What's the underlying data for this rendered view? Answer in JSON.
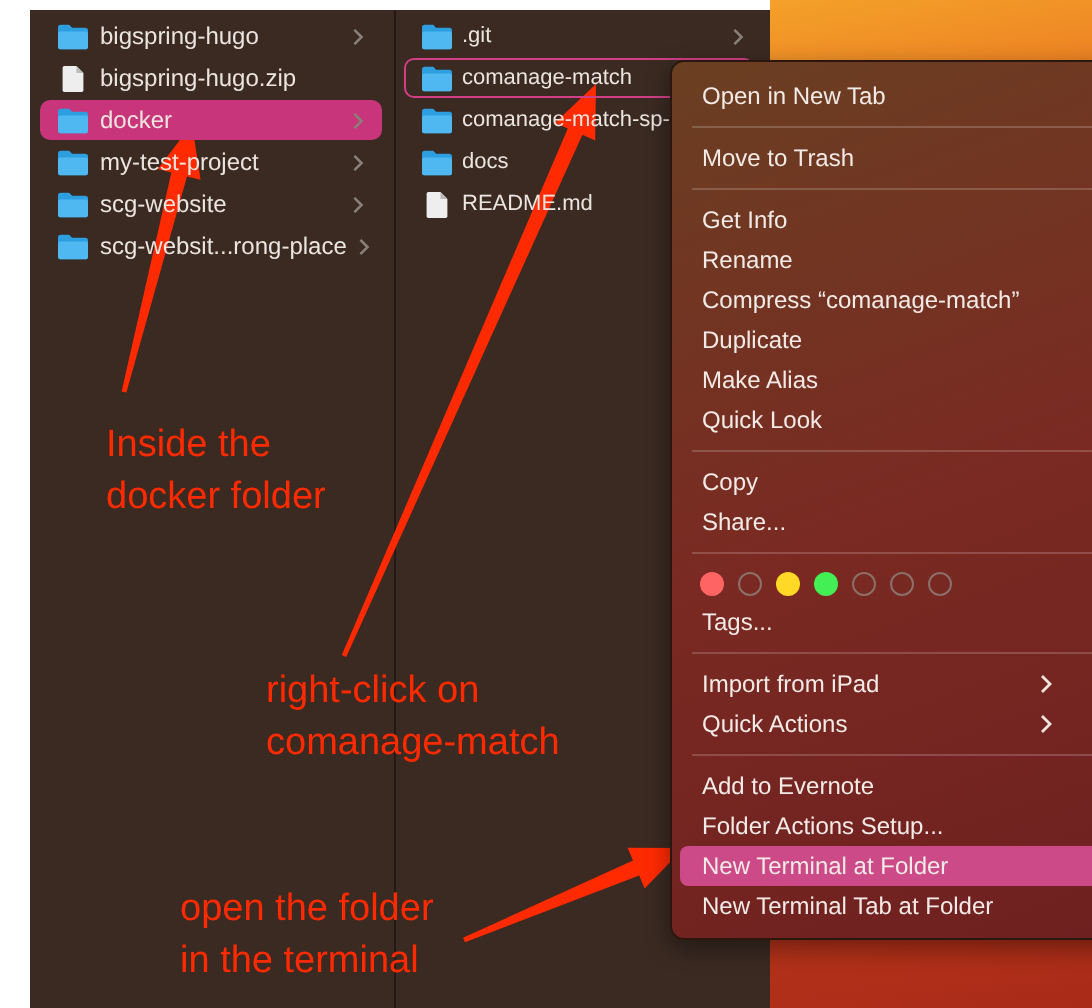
{
  "finder": {
    "columns": [
      {
        "items": [
          {
            "name": "bigspring-hugo",
            "kind": "folder",
            "selected": false,
            "context_target": false,
            "has_children": true
          },
          {
            "name": "bigspring-hugo.zip",
            "kind": "file",
            "selected": false,
            "context_target": false,
            "has_children": false
          },
          {
            "name": "docker",
            "kind": "folder",
            "selected": true,
            "context_target": false,
            "has_children": true
          },
          {
            "name": "my-test-project",
            "kind": "folder",
            "selected": false,
            "context_target": false,
            "has_children": true
          },
          {
            "name": "scg-website",
            "kind": "folder",
            "selected": false,
            "context_target": false,
            "has_children": true
          },
          {
            "name": "scg-websit...rong-place",
            "kind": "folder",
            "selected": false,
            "context_target": false,
            "has_children": true
          }
        ]
      },
      {
        "items": [
          {
            "name": ".git",
            "kind": "folder",
            "selected": false,
            "context_target": false,
            "has_children": true
          },
          {
            "name": "comanage-match",
            "kind": "folder",
            "selected": false,
            "context_target": true,
            "has_children": false
          },
          {
            "name": "comanage-match-sp-",
            "kind": "folder",
            "selected": false,
            "context_target": false,
            "has_children": false
          },
          {
            "name": "docs",
            "kind": "folder",
            "selected": false,
            "context_target": false,
            "has_children": false
          },
          {
            "name": "README.md",
            "kind": "file",
            "selected": false,
            "context_target": false,
            "has_children": false
          }
        ]
      }
    ]
  },
  "context_menu": {
    "sections": [
      {
        "items": [
          {
            "label": "Open in New Tab",
            "selected": false,
            "has_submenu": false
          }
        ]
      },
      {
        "items": [
          {
            "label": "Move to Trash",
            "selected": false,
            "has_submenu": false
          }
        ]
      },
      {
        "items": [
          {
            "label": "Get Info",
            "selected": false,
            "has_submenu": false
          },
          {
            "label": "Rename",
            "selected": false,
            "has_submenu": false
          },
          {
            "label": "Compress “comanage-match”",
            "selected": false,
            "has_submenu": false
          },
          {
            "label": "Duplicate",
            "selected": false,
            "has_submenu": false
          },
          {
            "label": "Make Alias",
            "selected": false,
            "has_submenu": false
          },
          {
            "label": "Quick Look",
            "selected": false,
            "has_submenu": false
          }
        ]
      },
      {
        "items": [
          {
            "label": "Copy",
            "selected": false,
            "has_submenu": false
          },
          {
            "label": "Share...",
            "selected": false,
            "has_submenu": false
          }
        ]
      },
      {
        "tag_dots": [
          {
            "kind": "filled",
            "color": "#ff6464"
          },
          {
            "kind": "empty"
          },
          {
            "kind": "filled",
            "color": "#ffd926"
          },
          {
            "kind": "filled",
            "color": "#44ee55"
          },
          {
            "kind": "empty"
          },
          {
            "kind": "empty"
          },
          {
            "kind": "empty"
          }
        ],
        "items": [
          {
            "label": "Tags...",
            "selected": false,
            "has_submenu": false
          }
        ]
      },
      {
        "items": [
          {
            "label": "Import from iPad",
            "selected": false,
            "has_submenu": true
          },
          {
            "label": "Quick Actions",
            "selected": false,
            "has_submenu": true
          }
        ]
      },
      {
        "items": [
          {
            "label": "Add to Evernote",
            "selected": false,
            "has_submenu": false
          },
          {
            "label": "Folder Actions Setup...",
            "selected": false,
            "has_submenu": false
          },
          {
            "label": "New Terminal at Folder",
            "selected": true,
            "has_submenu": false
          },
          {
            "label": "New Terminal Tab at Folder",
            "selected": false,
            "has_submenu": false
          }
        ]
      }
    ]
  },
  "annotations": [
    {
      "lines": [
        "Inside the",
        "docker folder"
      ]
    },
    {
      "lines": [
        "right-click on",
        "comanage-match"
      ]
    },
    {
      "lines": [
        "open the folder",
        "in the terminal"
      ]
    }
  ]
}
